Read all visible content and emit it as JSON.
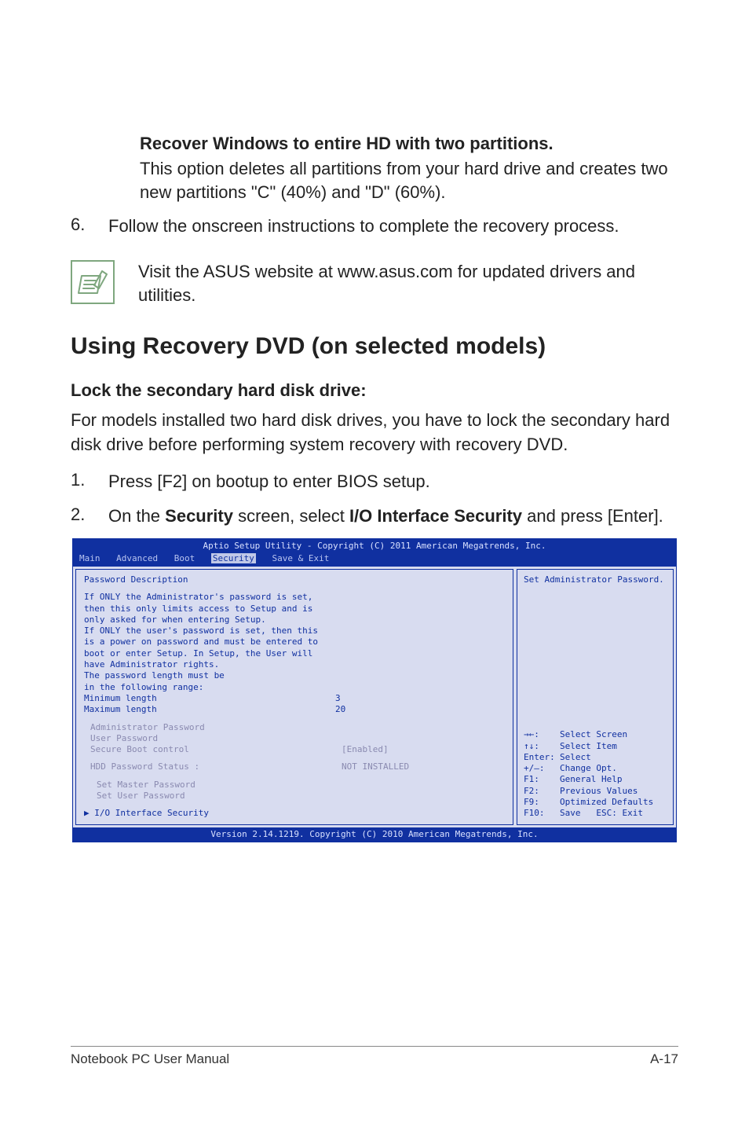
{
  "recover": {
    "option_title": "Recover Windows to entire HD with two partitions.",
    "option_body": "This option deletes all partitions from your hard drive and creates two new partitions \"C\" (40%) and \"D\" (60%)."
  },
  "step6": {
    "num": "6.",
    "text": "Follow the onscreen instructions to complete the recovery process."
  },
  "note": {
    "text": "Visit the ASUS website at www.asus.com for updated drivers and utilities."
  },
  "section_title": "Using Recovery DVD (on selected models)",
  "subheading": "Lock the secondary hard disk drive:",
  "para": "For models installed two hard disk drives, you have to lock the secondary hard disk drive before performing system recovery with recovery DVD.",
  "step1": {
    "num": "1.",
    "text": "Press [F2] on bootup to enter BIOS setup."
  },
  "step2": {
    "num": "2.",
    "pre": "On the ",
    "b1": "Security",
    "mid": " screen, select ",
    "b2": "I/O Interface Security",
    "post": " and press [Enter]."
  },
  "bios": {
    "title": "Aptio Setup Utility - Copyright (C) 2011 American Megatrends, Inc.",
    "tabs": {
      "main": "Main",
      "advanced": "Advanced",
      "boot": "Boot",
      "security": "Security",
      "save": "Save & Exit"
    },
    "left": {
      "pd": "Password Description",
      "l1": "If ONLY the Administrator's password is set,",
      "l2": "then this only limits access to Setup and is",
      "l3": "only asked for when entering Setup.",
      "l4": "If ONLY the user's password is set, then this",
      "l5": "is a power on password and must be entered to",
      "l6": "boot or enter Setup. In Setup, the User will",
      "l7": "have Administrator rights.",
      "l8": "The password length must be",
      "l9": "in the following range:",
      "minl": "Minimum length",
      "minv": "3",
      "maxl": "Maximum length",
      "maxv": "20",
      "admin": "Administrator Password",
      "user": "User Password",
      "sbc": "Secure Boot control",
      "sbcv": "[Enabled]",
      "hdd": "HDD Password Status :",
      "hddv": "NOT INSTALLED",
      "smp": "Set Master Password",
      "sup": "Set User Password",
      "io": "I/O Interface Security",
      "tri": "▶"
    },
    "right": {
      "help": "Set Administrator Password.",
      "k_ss": "Select Screen",
      "a_ss": "→←:",
      "k_si": "Select Item",
      "a_si": "↑↓:",
      "k_en": "Select",
      "a_en": "Enter:",
      "k_co": "Change Opt.",
      "a_co": "+/—:",
      "k_f1": "General Help",
      "a_f1": "F1:",
      "k_f2": "Previous Values",
      "a_f2": "F2:",
      "k_f9": "Optimized Defaults",
      "a_f9": "F9:",
      "k_f10a": "Save",
      "k_f10b": "Exit",
      "a_f10": "F10:",
      "a_esc": "ESC:"
    },
    "footer": "Version 2.14.1219. Copyright (C) 2010 American Megatrends, Inc."
  },
  "footer": {
    "left": "Notebook PC User Manual",
    "right": "A-17"
  }
}
